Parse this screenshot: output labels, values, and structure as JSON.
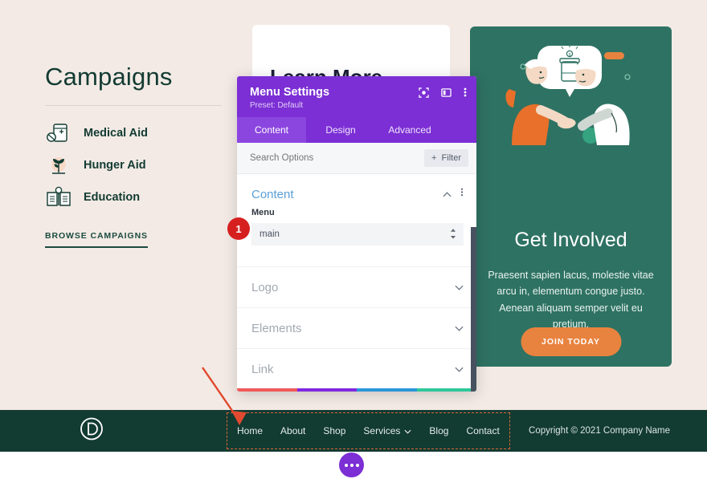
{
  "page": {
    "background_color": "#f3eae5"
  },
  "campaigns": {
    "title": "Campaigns",
    "items": [
      {
        "label": "Medical Aid",
        "icon": "medicine-box-icon"
      },
      {
        "label": "Hunger Aid",
        "icon": "plant-sprout-icon"
      },
      {
        "label": "Education",
        "icon": "open-book-icon"
      }
    ],
    "browse_label": "BROWSE CAMPAIGNS"
  },
  "learn_card": {
    "title": "Learn More"
  },
  "green_card": {
    "title": "Get Involved",
    "body": "Praesent sapien lacus, molestie vitae arcu in, elementum congue justo. Aenean aliquam semper velit eu pretium.",
    "button_label": "JOIN TODAY",
    "background_color": "#2e7263",
    "button_color": "#e8833f",
    "illustration": "handshake-donation-illustration"
  },
  "modal": {
    "title": "Menu Settings",
    "preset": "Preset: Default",
    "header_icons": [
      "focus-target-icon",
      "layout-panel-icon",
      "vertical-dots-icon"
    ],
    "accent_color": "#7b2fd4",
    "tabs": [
      {
        "label": "Content",
        "active": true
      },
      {
        "label": "Design",
        "active": false
      },
      {
        "label": "Advanced",
        "active": false
      }
    ],
    "search": {
      "placeholder": "Search Options",
      "value": "",
      "filter_label": "Filter"
    },
    "content_section": {
      "title": "Content",
      "collapse_icon": "chevron-up-icon",
      "more_icon": "vertical-dots-icon",
      "field_label": "Menu",
      "field_value": "main",
      "field_options": [
        "main"
      ]
    },
    "accordions": [
      {
        "label": "Logo",
        "icon": "chevron-down-icon"
      },
      {
        "label": "Elements",
        "icon": "chevron-down-icon"
      },
      {
        "label": "Link",
        "icon": "chevron-down-icon"
      }
    ],
    "actions": [
      {
        "name": "cancel",
        "icon": "close-x-icon",
        "color": "#f05a5a"
      },
      {
        "name": "undo",
        "icon": "undo-arrow-icon",
        "color": "#8028df"
      },
      {
        "name": "redo",
        "icon": "redo-arrow-icon",
        "color": "#2b96d8"
      },
      {
        "name": "save",
        "icon": "checkmark-icon",
        "color": "#2fc79a"
      }
    ]
  },
  "annotation": {
    "step_number": "1",
    "badge_color": "#d62020",
    "arrow_color": "#e04a2f",
    "highlight_border_color": "#d9663a"
  },
  "site_footer": {
    "logo": "divi-d-logo",
    "menu": [
      {
        "label": "Home",
        "has_caret": false
      },
      {
        "label": "About",
        "has_caret": false
      },
      {
        "label": "Shop",
        "has_caret": false
      },
      {
        "label": "Services",
        "has_caret": true
      },
      {
        "label": "Blog",
        "has_caret": false
      },
      {
        "label": "Contact",
        "has_caret": false
      }
    ],
    "copyright": "Copyright © 2021 Company Name",
    "background_color": "#123b32"
  },
  "fab": {
    "icon": "three-dots-icon"
  }
}
